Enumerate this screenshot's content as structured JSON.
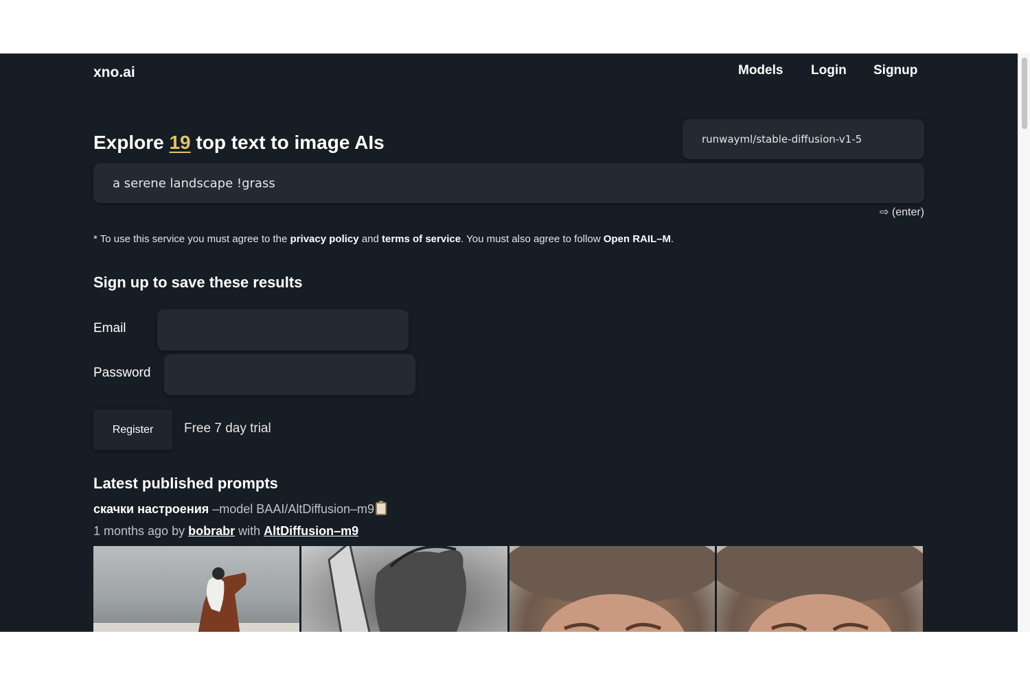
{
  "header": {
    "brand": "xno.ai",
    "nav": [
      "Models",
      "Login",
      "Signup"
    ]
  },
  "hero": {
    "title_pre": "Explore ",
    "title_count": "19",
    "title_post": " top text to image AIs",
    "model_value": "runwayml/stable-diffusion-v1-5",
    "prompt_value": "a serene landscape !grass",
    "enter_hint": "⇨ (enter)"
  },
  "legal": {
    "t1": "* To use this service you must agree to the ",
    "privacy": "privacy policy",
    "t2": " and ",
    "terms": "terms of service",
    "t3": ". You must also agree to follow ",
    "rail": "Open RAIL–M",
    "t4": "."
  },
  "signup": {
    "heading": "Sign up to save these results",
    "email_label": "Email",
    "password_label": "Password",
    "register_label": "Register",
    "trial_text": "Free 7 day trial"
  },
  "latest": {
    "heading": "Latest published prompts",
    "prompt_text": "скачки настроения",
    "prompt_model": " –model BAAI/AltDiffusion–m9",
    "meta_time": "1 months ago by ",
    "meta_user": "bobrabr",
    "meta_with": " with ",
    "meta_model": "AltDiffusion–m9"
  }
}
